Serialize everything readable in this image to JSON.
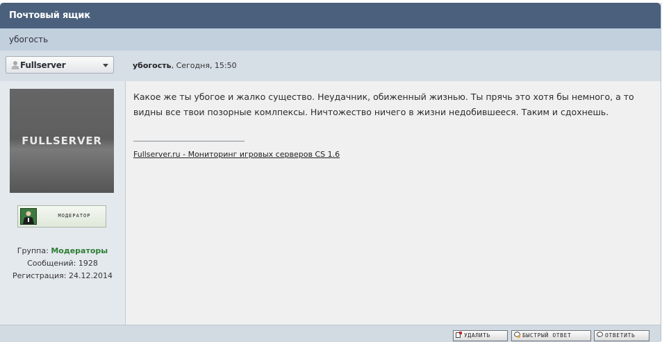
{
  "header": {
    "title": "Почтовый ящик"
  },
  "subject": {
    "text": "убогость"
  },
  "post": {
    "user_select": {
      "selected": "Fullserver"
    },
    "meta": {
      "author": "убогость",
      "date": ", Сегодня, 15:50"
    },
    "body": "Какое же ты убогое и жалко существо. Неудачник, обиженный жизнью. Ты прячь это хотя бы немного, а то видны все твои позорные комлпексы. Ничтожество ничего в жизни недобившееся. Таким и сдохнешь.",
    "signature": {
      "link_text": "Fullserver.ru - Мониторинг игровых серверов CS 1.6"
    }
  },
  "author": {
    "avatar_text": "FULLSERVER",
    "rank_label": "МОДЕРАТОР",
    "group_label": "Группа: ",
    "group_value": "Модераторы",
    "messages": "Сообщений: 1928",
    "registered": "Регистрация: 24.12.2014"
  },
  "footer": {
    "delete_label": "УДАЛИТЬ",
    "quick_reply_label": "БЫСТРЫЙ ОТВЕТ",
    "reply_label": "ОТВЕТИТЬ"
  },
  "colors": {
    "title_bar": "#4a607c",
    "subject_bar": "#c2d0de",
    "group_green": "#2e7d32"
  },
  "icons": {
    "user": "user-icon",
    "dropdown": "chevron-down-icon",
    "delete": "delete-icon",
    "quick_reply": "quick-reply-icon",
    "reply": "reply-icon"
  }
}
